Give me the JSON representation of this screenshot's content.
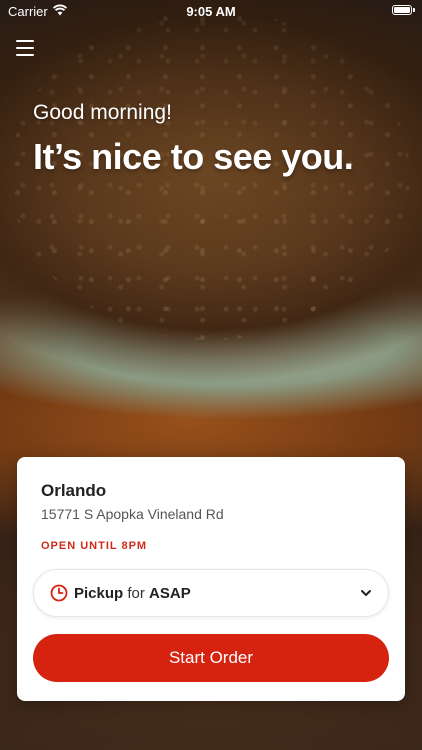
{
  "status_bar": {
    "carrier": "Carrier",
    "time": "9:05 AM"
  },
  "header": {
    "menu_icon": "hamburger-menu-icon",
    "greeting": "Good morning!",
    "headline": "It’s nice to see you."
  },
  "store_card": {
    "name": "Orlando",
    "address": "15771 S Apopka Vineland Rd",
    "hours": "OPEN UNTIL 8PM",
    "order_type": "Pickup",
    "connector": "for",
    "time": "ASAP",
    "clock_icon": "clock-icon",
    "chevron_icon": "chevron-down-icon",
    "start_button": "Start Order"
  },
  "colors": {
    "accent_red": "#d6230f",
    "hours_red": "#cf2b1b",
    "card_bg": "#ffffff"
  }
}
